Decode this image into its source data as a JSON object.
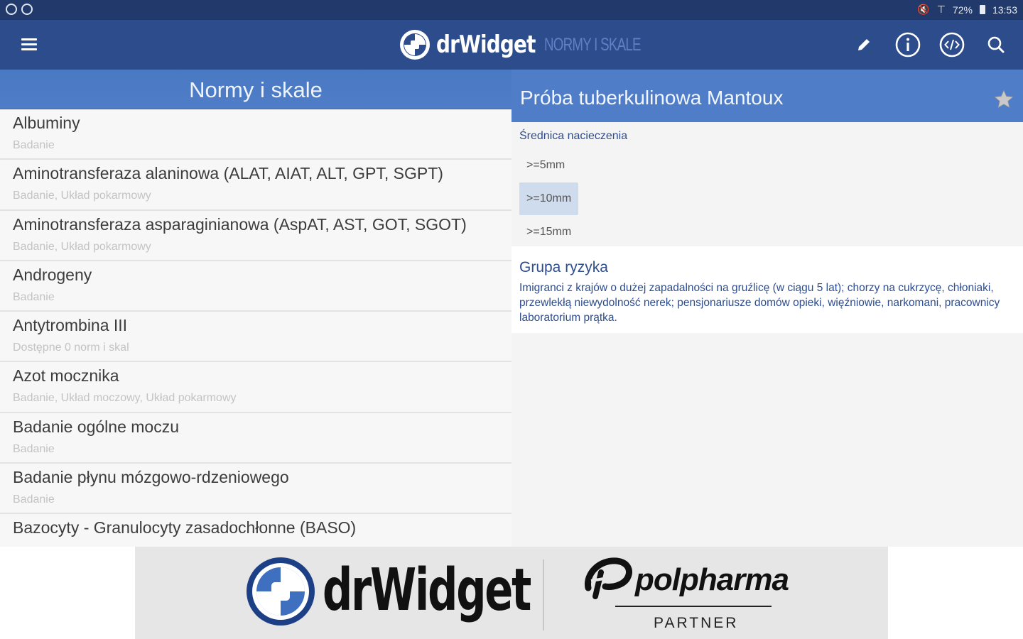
{
  "status_bar": {
    "right_text": "72%",
    "time": "13:53"
  },
  "appbar": {
    "brand_name": "drWidget",
    "brand_sub": "NORMY I SKALE",
    "actions": [
      "edit-icon",
      "info-icon",
      "code-icon",
      "search-icon"
    ]
  },
  "left": {
    "header": "Normy i skale",
    "items": [
      {
        "title": "Albuminy",
        "sub": "Badanie"
      },
      {
        "title": "Aminotransferaza alaninowa (ALAT, AIAT, ALT, GPT, SGPT)",
        "sub": "Badanie, Układ pokarmowy"
      },
      {
        "title": "Aminotransferaza asparaginianowa (AspAT, AST, GOT, SGOT)",
        "sub": "Badanie, Układ pokarmowy"
      },
      {
        "title": "Androgeny",
        "sub": "Badanie"
      },
      {
        "title": "Antytrombina III",
        "sub": "Dostępne 0 norm i skal"
      },
      {
        "title": "Azot mocznika",
        "sub": "Badanie, Układ moczowy, Układ pokarmowy"
      },
      {
        "title": "Badanie ogólne moczu",
        "sub": "Badanie"
      },
      {
        "title": "Badanie płynu mózgowo-rdzeniowego",
        "sub": "Badanie"
      },
      {
        "title": "Bazocyty - Granulocyty zasadochłonne (BASO)",
        "sub": ""
      }
    ]
  },
  "right": {
    "header": "Próba tuberkulinowa Mantoux",
    "field_label": "Średnica nacieczenia",
    "options": [
      ">=5mm",
      ">=10mm",
      ">=15mm"
    ],
    "selected_option": ">=10mm",
    "result_title": "Grupa ryzyka",
    "result_text": "Imigranci z krajów o dużej zapadalności na gruźlicę (w ciągu 5 lat); chorzy na cukrzycę, chłoniaki, przewlekłą niewydolność nerek; pensjonariusze domów opieki, więźniowie, narkomani, pracownicy laboratorium prątka."
  },
  "banner": {
    "brand_text": "drWidget",
    "partner_name": "polpharma",
    "partner_label": "PARTNER"
  },
  "colors": {
    "status_bar": "#21396b",
    "appbar": "#2c4c8c",
    "header_blue": "#4f7dc8",
    "text_blue": "#2d4d8e",
    "selected_bg": "#cfdced"
  }
}
